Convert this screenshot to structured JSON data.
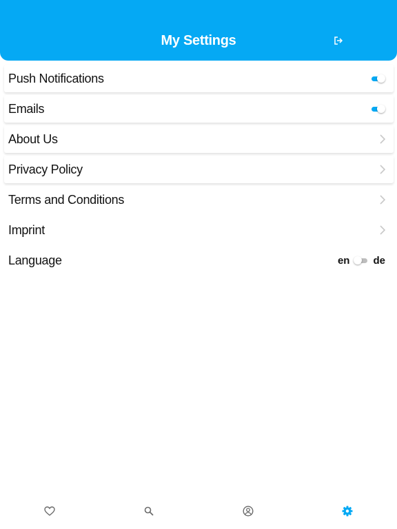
{
  "header": {
    "title": "My Settings",
    "logout_icon": "logout-icon"
  },
  "settings": [
    {
      "label": "Push Notifications",
      "control": "toggle",
      "enabled": true
    },
    {
      "label": "Emails",
      "control": "toggle",
      "enabled": true
    },
    {
      "label": "About Us",
      "control": "chevron"
    },
    {
      "label": "Privacy Policy",
      "control": "chevron"
    },
    {
      "label": "Terms and Conditions",
      "control": "chevron"
    },
    {
      "label": "Imprint",
      "control": "chevron"
    },
    {
      "label": "Language",
      "control": "language-toggle",
      "left": "en",
      "right": "de",
      "selected": "en"
    }
  ],
  "bottom_nav": [
    {
      "icon": "heart-icon",
      "active": false
    },
    {
      "icon": "search-icon",
      "active": false
    },
    {
      "icon": "account-circle-icon",
      "active": false
    },
    {
      "icon": "gear-icon",
      "active": true
    }
  ],
  "colors": {
    "accent": "#05a9f4",
    "inactive_icon": "#6b6b6b",
    "chevron": "#c8c8c8"
  }
}
